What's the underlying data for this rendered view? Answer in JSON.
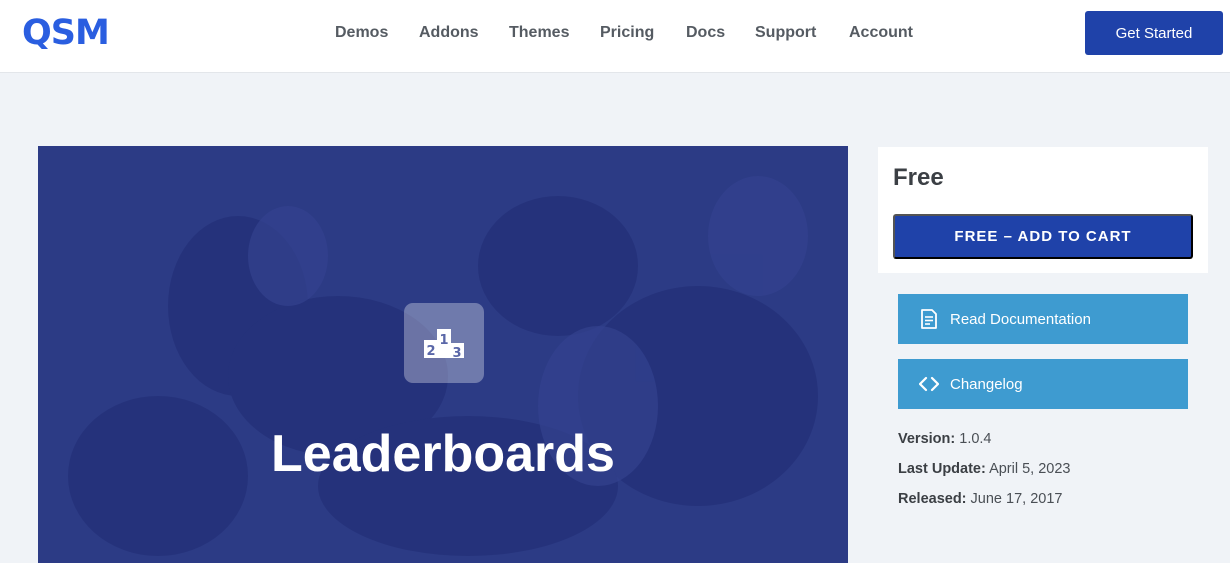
{
  "header": {
    "logo_text": "QSM",
    "nav": [
      "Demos",
      "Addons",
      "Themes",
      "Pricing",
      "Docs",
      "Support",
      "Account"
    ],
    "cta_label": "Get Started"
  },
  "hero": {
    "title": "Leaderboards",
    "icon": "podium-icon",
    "podium_numbers": [
      "2",
      "1",
      "3"
    ],
    "bg_color": "#2c3b85"
  },
  "sidebar": {
    "price_label": "Free",
    "add_to_cart_label": "FREE – ADD TO CART",
    "read_docs_label": "Read Documentation",
    "changelog_label": "Changelog",
    "version_label": "Version:",
    "version_value": "1.0.4",
    "last_update_label": "Last Update:",
    "last_update_value": "April 5, 2023",
    "released_label": "Released:",
    "released_value": "June 17, 2017"
  },
  "colors": {
    "brand_blue": "#1f42a9",
    "logo_blue": "#2a5ee0",
    "light_blue_button": "#3e9bd0"
  }
}
